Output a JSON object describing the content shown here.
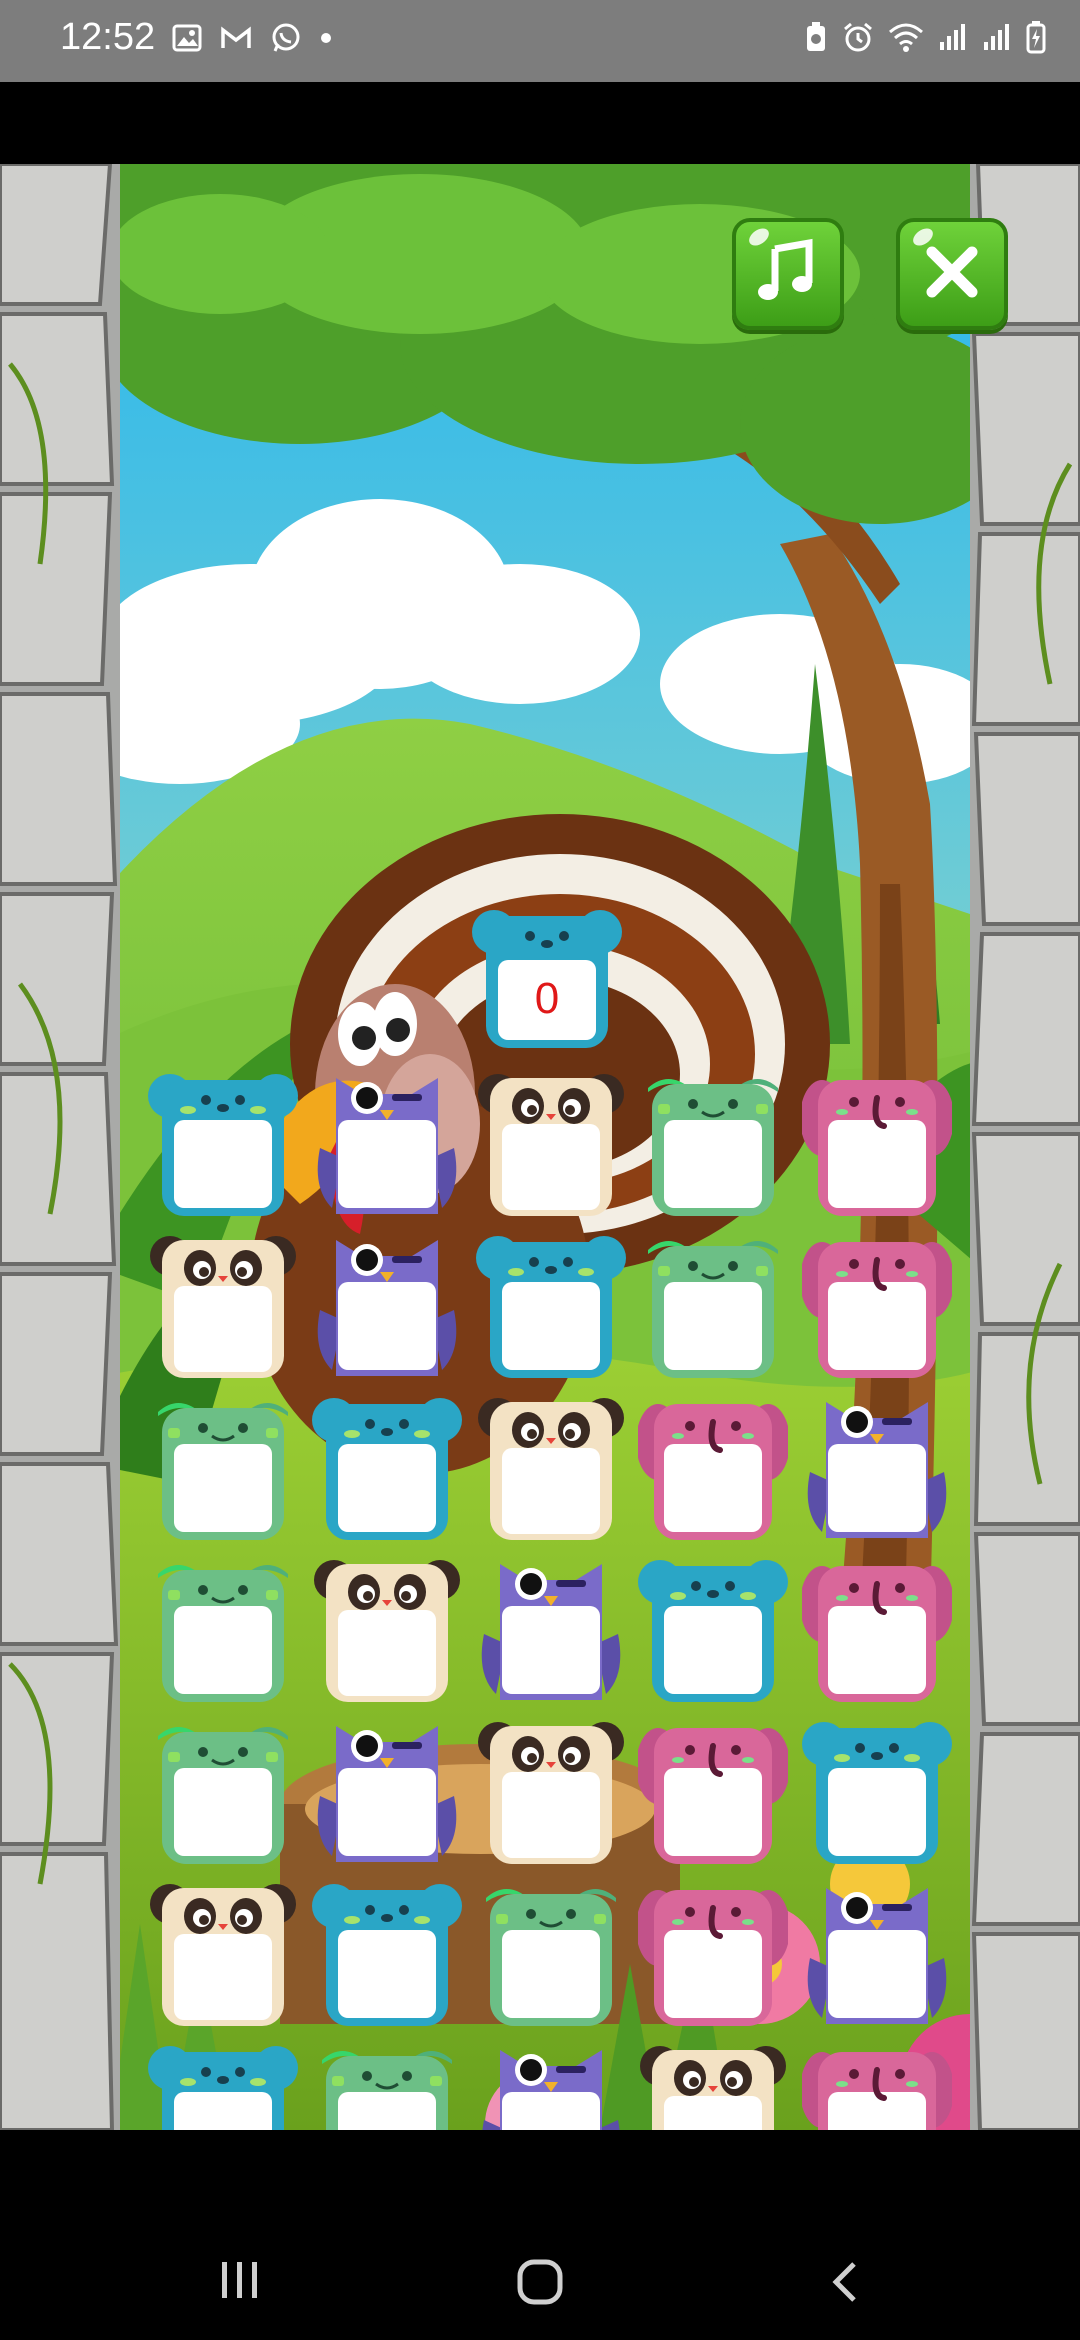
{
  "status_bar": {
    "time": "12:52",
    "left_icons": [
      "image-icon",
      "gmail-icon",
      "whatsapp-icon",
      "dot-icon"
    ],
    "right_icons": [
      "battery-saver-icon",
      "alarm-icon",
      "wifi-icon",
      "signal-icon",
      "signal-icon",
      "battery-charging-icon"
    ]
  },
  "controls": {
    "music": "music-note-icon",
    "close": "close-x-icon"
  },
  "score": {
    "value": "0"
  },
  "board": {
    "rows": [
      [
        "blue-bear",
        "purple-owl",
        "panda",
        "green-frog",
        "pink-elephant"
      ],
      [
        "panda",
        "purple-owl",
        "blue-bear",
        "green-frog",
        "pink-elephant"
      ],
      [
        "green-frog",
        "blue-bear",
        "panda",
        "pink-elephant",
        "purple-owl"
      ],
      [
        "green-frog",
        "panda",
        "purple-owl",
        "blue-bear",
        "pink-elephant"
      ],
      [
        "green-frog",
        "purple-owl",
        "panda",
        "pink-elephant",
        "blue-bear"
      ],
      [
        "panda",
        "blue-bear",
        "green-frog",
        "pink-elephant",
        "purple-owl"
      ],
      [
        "blue-bear",
        "green-frog",
        "purple-owl",
        "panda",
        "pink-elephant"
      ]
    ]
  },
  "colors": {
    "blue-bear": "#2aa6c6",
    "purple-owl": "#7a6bc9",
    "panda": "#f3e2c4",
    "green-frog": "#6cbf86",
    "pink-elephant": "#d9679a",
    "button_green": "#4fb423"
  },
  "nav_bar": [
    "recents-icon",
    "home-icon",
    "back-icon"
  ]
}
